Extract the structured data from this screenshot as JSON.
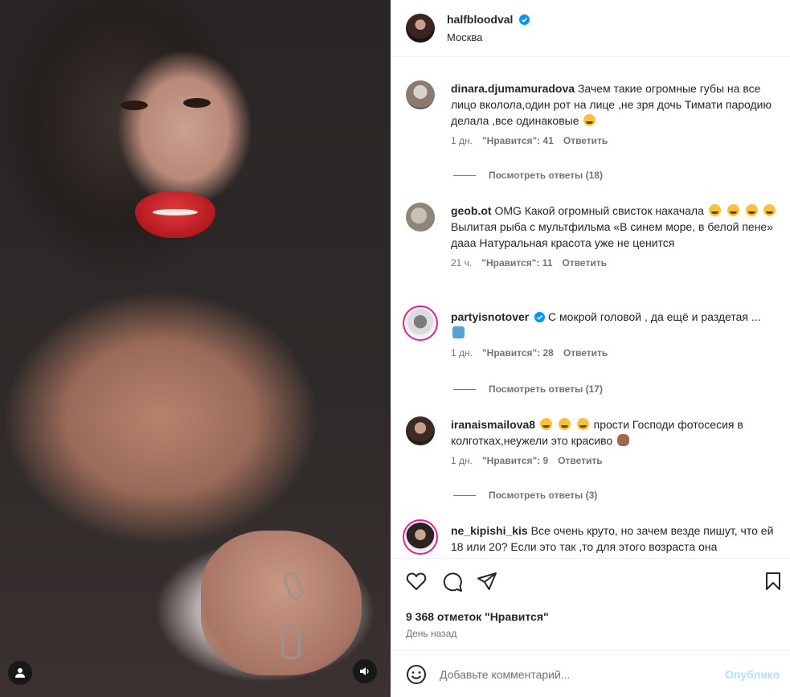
{
  "post": {
    "username": "halfbloodval",
    "location": "Москва",
    "likes": "9 368 отметок \"Нравится\"",
    "time": "День назад"
  },
  "comments": [
    {
      "username": "dinara.djumamuradova",
      "text": "Зачем такие огромные губы на все лицо вколола,один рот на лице ,не зря дочь Тимати пародию делала ,все одинаковые",
      "time": "1 дн.",
      "likes": "\"Нравится\": 41",
      "reply": "Ответить",
      "view_replies": "Посмотреть ответы (18)"
    },
    {
      "username": "geob.ot",
      "text": "OMG Какой огромный свисток накачала",
      "text2": "Вылитая рыба с мультфильма «В синем море, в белой пене»",
      "text3": "дааа Натуральная красота уже не ценится",
      "time": "21 ч.",
      "likes": "\"Нравится\": 11",
      "reply": "Ответить"
    },
    {
      "username": "partyisnotover",
      "text": "С мокрой головой , да ещё и раздетая ...",
      "time": "1 дн.",
      "likes": "\"Нравится\": 28",
      "reply": "Ответить",
      "view_replies": "Посмотреть ответы (17)"
    },
    {
      "username": "iranaismailova8",
      "text": "прости Господи фотосесия в колготках,неужели это красиво",
      "time": "1 дн.",
      "likes": "\"Нравится\": 9",
      "reply": "Ответить",
      "view_replies": "Посмотреть ответы (3)"
    },
    {
      "username": "ne_kipishi_kis",
      "text": "Все очень круто, но зачем везде пишут, что ей 18 или 20? Если это так ,то для этого возраста она"
    }
  ],
  "add_comment": {
    "placeholder": "Добавьте комментарий...",
    "post_label": "Опублико"
  },
  "colors": {
    "verified": "#0095f6",
    "story_ring": "#d6249f",
    "secondary_text": "#737373",
    "post_button_disabled": "#b2dffc"
  },
  "icons": [
    "user-tag-icon",
    "sound-icon",
    "verified-badge-icon",
    "heart-icon",
    "comment-icon",
    "share-icon",
    "bookmark-icon",
    "emoji-icon"
  ]
}
